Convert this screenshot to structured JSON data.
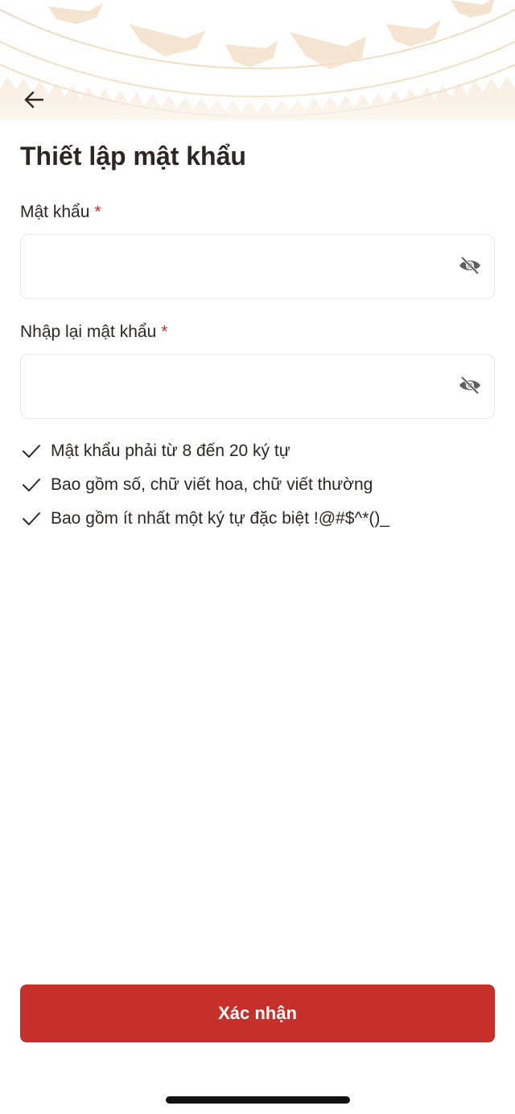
{
  "header": {
    "back_icon": "arrow-left-icon",
    "title": "Thiết lập mật khẩu"
  },
  "form": {
    "password": {
      "label": "Mật khẩu",
      "required_mark": "*",
      "value": "",
      "toggle_icon": "eye-off-icon"
    },
    "confirm_password": {
      "label": "Nhập lại mật khẩu",
      "required_mark": "*",
      "value": "",
      "toggle_icon": "eye-off-icon"
    }
  },
  "rules": [
    {
      "icon": "check-icon",
      "text": "Mật khẩu phải từ 8 đến 20 ký tự"
    },
    {
      "icon": "check-icon",
      "text": "Bao gồm số, chữ viết hoa, chữ viết thường"
    },
    {
      "icon": "check-icon",
      "text": "Bao gồm ít nhất một ký tự đặc biệt !@#$^*()_"
    }
  ],
  "actions": {
    "confirm_label": "Xác nhận"
  },
  "colors": {
    "accent": "#c6302b",
    "pattern": "#f3e1c8",
    "text": "#2e2624"
  }
}
